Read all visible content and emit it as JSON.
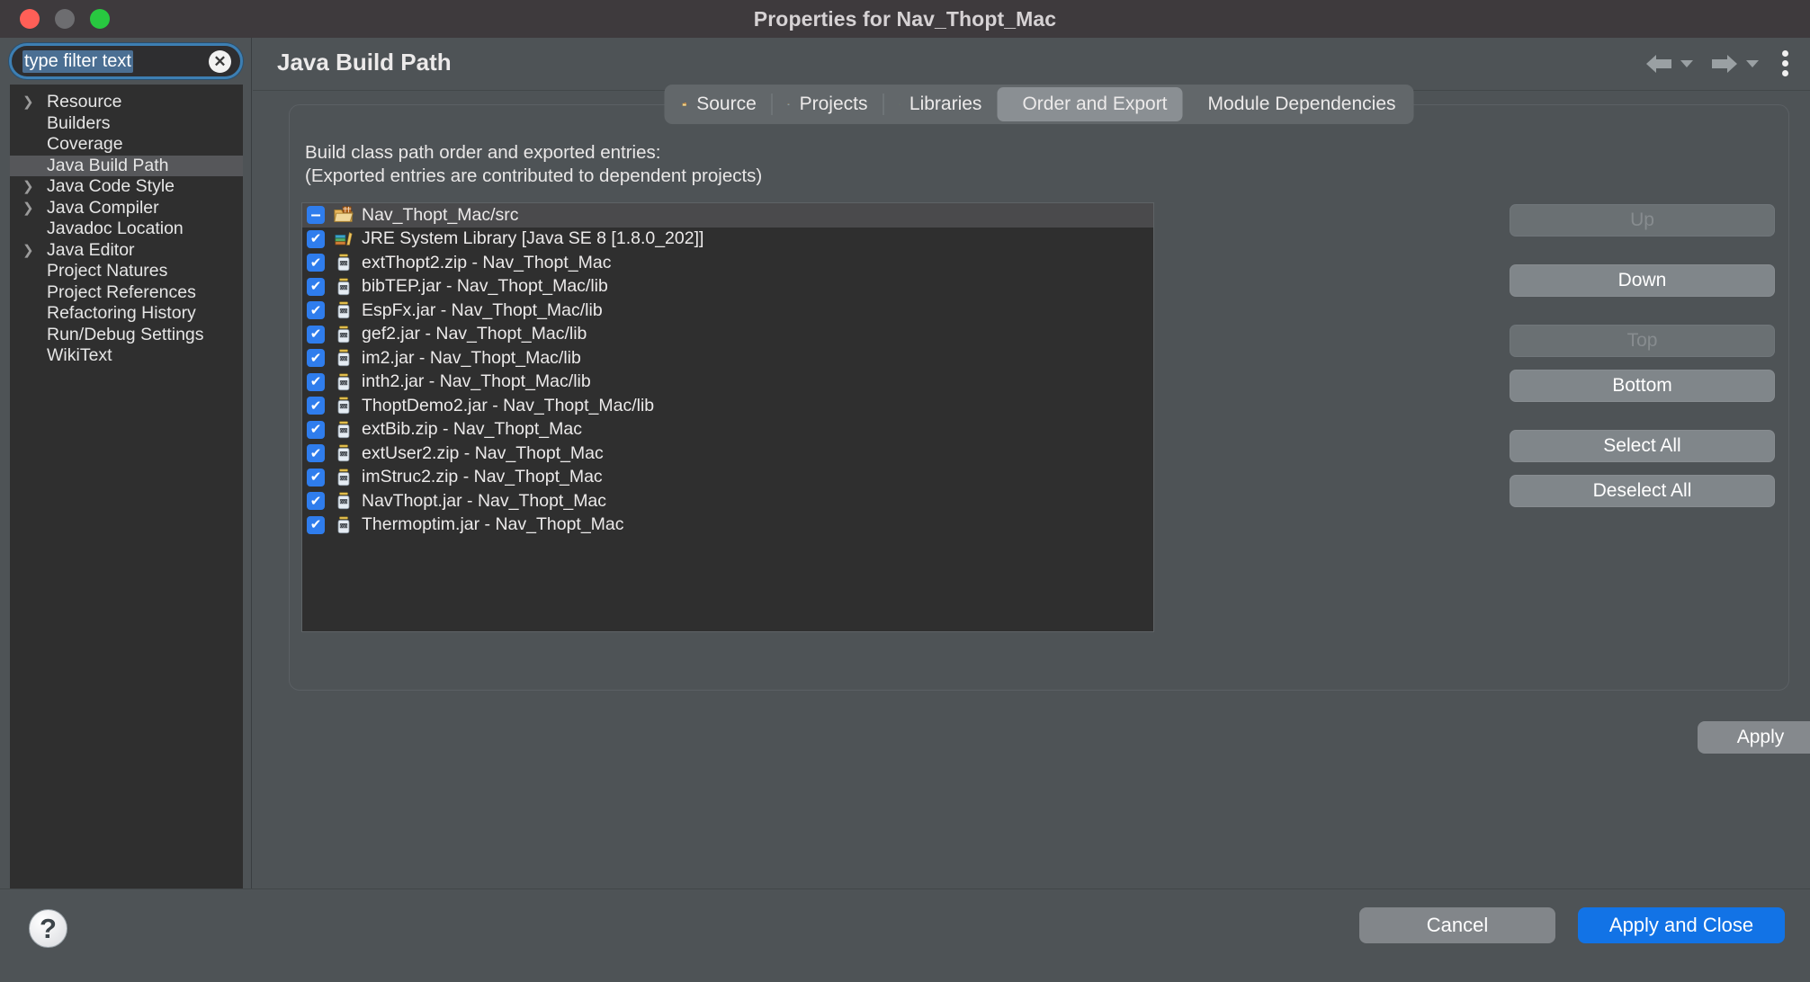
{
  "window": {
    "title": "Properties for Nav_Thopt_Mac",
    "traffic_lights": [
      "close",
      "minimize",
      "zoom"
    ]
  },
  "sidebar": {
    "filter": {
      "value": "type filter text",
      "placeholder": "type filter text",
      "clear_icon": "close-icon"
    },
    "items": [
      {
        "label": "Resource",
        "expandable": true,
        "selected": false
      },
      {
        "label": "Builders",
        "expandable": false,
        "selected": false
      },
      {
        "label": "Coverage",
        "expandable": false,
        "selected": false
      },
      {
        "label": "Java Build Path",
        "expandable": false,
        "selected": true
      },
      {
        "label": "Java Code Style",
        "expandable": true,
        "selected": false
      },
      {
        "label": "Java Compiler",
        "expandable": true,
        "selected": false
      },
      {
        "label": "Javadoc Location",
        "expandable": false,
        "selected": false
      },
      {
        "label": "Java Editor",
        "expandable": true,
        "selected": false
      },
      {
        "label": "Project Natures",
        "expandable": false,
        "selected": false
      },
      {
        "label": "Project References",
        "expandable": false,
        "selected": false
      },
      {
        "label": "Refactoring History",
        "expandable": false,
        "selected": false
      },
      {
        "label": "Run/Debug Settings",
        "expandable": false,
        "selected": false
      },
      {
        "label": "WikiText",
        "expandable": false,
        "selected": false
      }
    ]
  },
  "header": {
    "title": "Java Build Path",
    "back_icon": "back-arrow-icon",
    "forward_icon": "forward-arrow-icon",
    "menu_icon": "kebab-menu-icon"
  },
  "tabs": [
    {
      "label": "Source",
      "icon": "source-folder-icon",
      "active": false
    },
    {
      "label": "Projects",
      "icon": "projects-folder-icon",
      "active": false
    },
    {
      "label": "Libraries",
      "icon": "libraries-books-icon",
      "active": false
    },
    {
      "label": "Order and Export",
      "icon": "order-export-arrows-icon",
      "active": true
    },
    {
      "label": "Module Dependencies",
      "icon": "module-m-icon",
      "active": false
    }
  ],
  "main": {
    "description_line1": "Build class path order and exported entries:",
    "description_line2": "(Exported entries are contributed to dependent projects)",
    "entries": [
      {
        "label": "Nav_Thopt_Mac/src",
        "checked": "partial",
        "icon": "source-folder-icon",
        "selected": true
      },
      {
        "label": "JRE System Library [Java SE 8 [1.8.0_202]]",
        "checked": "checked",
        "icon": "libraries-books-icon",
        "selected": false
      },
      {
        "label": "extThopt2.zip - Nav_Thopt_Mac",
        "checked": "checked",
        "icon": "jar-icon",
        "selected": false
      },
      {
        "label": "bibTEP.jar - Nav_Thopt_Mac/lib",
        "checked": "checked",
        "icon": "jar-icon",
        "selected": false
      },
      {
        "label": "EspFx.jar - Nav_Thopt_Mac/lib",
        "checked": "checked",
        "icon": "jar-icon",
        "selected": false
      },
      {
        "label": "gef2.jar - Nav_Thopt_Mac/lib",
        "checked": "checked",
        "icon": "jar-icon",
        "selected": false
      },
      {
        "label": "im2.jar - Nav_Thopt_Mac/lib",
        "checked": "checked",
        "icon": "jar-icon",
        "selected": false
      },
      {
        "label": "inth2.jar - Nav_Thopt_Mac/lib",
        "checked": "checked",
        "icon": "jar-icon",
        "selected": false
      },
      {
        "label": "ThoptDemo2.jar - Nav_Thopt_Mac/lib",
        "checked": "checked",
        "icon": "jar-icon",
        "selected": false
      },
      {
        "label": "extBib.zip - Nav_Thopt_Mac",
        "checked": "checked",
        "icon": "jar-icon",
        "selected": false
      },
      {
        "label": "extUser2.zip - Nav_Thopt_Mac",
        "checked": "checked",
        "icon": "jar-icon",
        "selected": false
      },
      {
        "label": "imStruc2.zip - Nav_Thopt_Mac",
        "checked": "checked",
        "icon": "jar-icon",
        "selected": false
      },
      {
        "label": "NavThopt.jar - Nav_Thopt_Mac",
        "checked": "checked",
        "icon": "jar-icon",
        "selected": false
      },
      {
        "label": "Thermoptim.jar - Nav_Thopt_Mac",
        "checked": "checked",
        "icon": "jar-icon",
        "selected": false
      }
    ],
    "side_buttons": [
      {
        "label": "Up",
        "enabled": false
      },
      {
        "label": "Down",
        "enabled": true
      },
      {
        "label": "Top",
        "enabled": false
      },
      {
        "label": "Bottom",
        "enabled": true
      },
      {
        "label": "Select All",
        "enabled": true
      },
      {
        "label": "Deselect All",
        "enabled": true
      }
    ],
    "apply_label": "Apply"
  },
  "footer": {
    "help_icon": "help-question-icon",
    "cancel_label": "Cancel",
    "apply_close_label": "Apply and Close"
  },
  "colors": {
    "accent": "#1273e6",
    "checkbox": "#2f7ded",
    "window_bg": "#4e5356",
    "list_bg": "#2f2f2f",
    "titlebar_bg": "#3e3a3d"
  }
}
